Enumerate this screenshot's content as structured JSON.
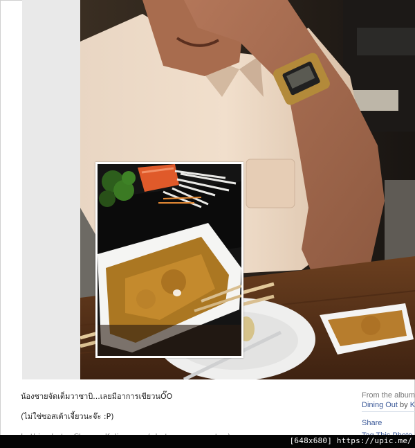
{
  "caption": {
    "line1": "น้องชายจัดเต็มวาซาบิ...เลยมีอาการเขียวนO๊O",
    "line2": "(ไม่ใช่ซอสเต้าเจี้ยวนะจ๊ะ :P)",
    "line3": "In this photo: Chanon Kalingamo (photos · remove tag)"
  },
  "album": {
    "from": "From the album:",
    "name": "Dining Out",
    "by": "by",
    "owner": "Ku",
    "share": "Share",
    "tag": "Tag This Photo"
  },
  "footer": {
    "label": "[648x680] https://upic.me/"
  },
  "colors": {
    "link": "#3b5998",
    "footer_bg": "#050505",
    "side_panel": "#e9e9e9"
  }
}
